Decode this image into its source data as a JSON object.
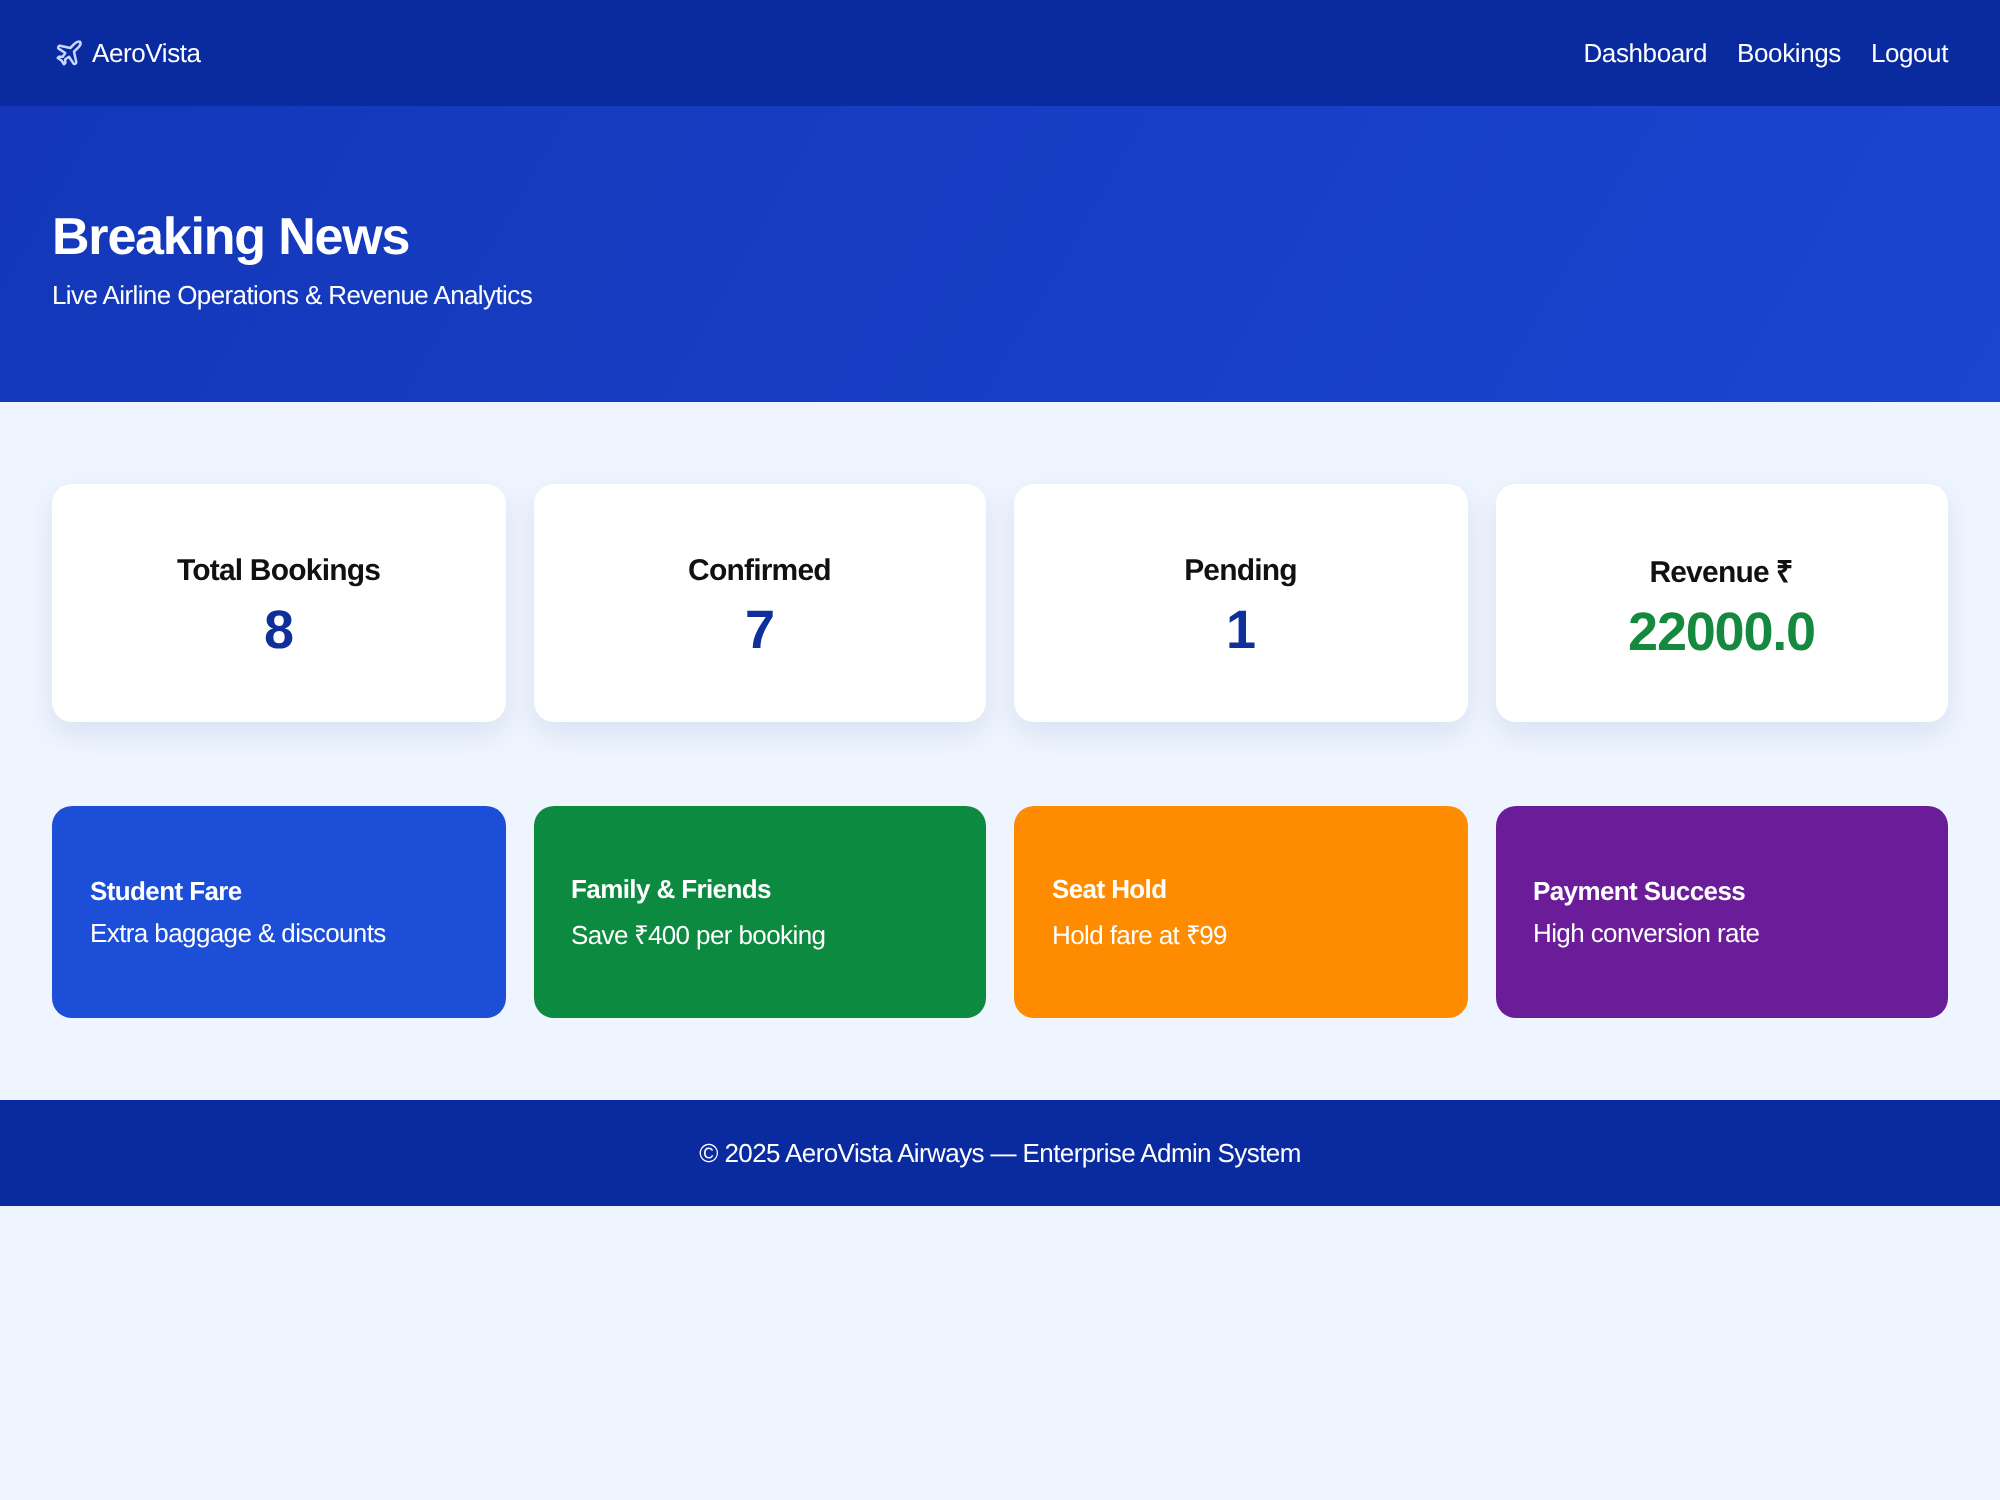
{
  "navbar": {
    "brand": "AeroVista",
    "links": [
      {
        "label": "Dashboard"
      },
      {
        "label": "Bookings"
      },
      {
        "label": "Logout"
      }
    ]
  },
  "hero": {
    "title": "Breaking News",
    "subtitle": "Live Airline Operations & Revenue Analytics"
  },
  "stats": [
    {
      "label": "Total Bookings",
      "value": "8",
      "kind": "count"
    },
    {
      "label": "Confirmed",
      "value": "7",
      "kind": "count"
    },
    {
      "label": "Pending",
      "value": "1",
      "kind": "count"
    },
    {
      "label": "Revenue ₹",
      "value": "22000.0",
      "kind": "money"
    }
  ],
  "promos": [
    {
      "title": "Student Fare",
      "text": "Extra baggage & discounts",
      "color": "#1d4ed8"
    },
    {
      "title": "Family & Friends",
      "text": "Save ₹400 per booking",
      "color": "#0b8a40"
    },
    {
      "title": "Seat Hold",
      "text": "Hold fare at ₹99",
      "color": "#ff8c00"
    },
    {
      "title": "Payment Success",
      "text": "High conversion rate",
      "color": "#6b1d99"
    }
  ],
  "footer": {
    "text": "© 2025 AeroVista Airways — Enterprise Admin System"
  }
}
